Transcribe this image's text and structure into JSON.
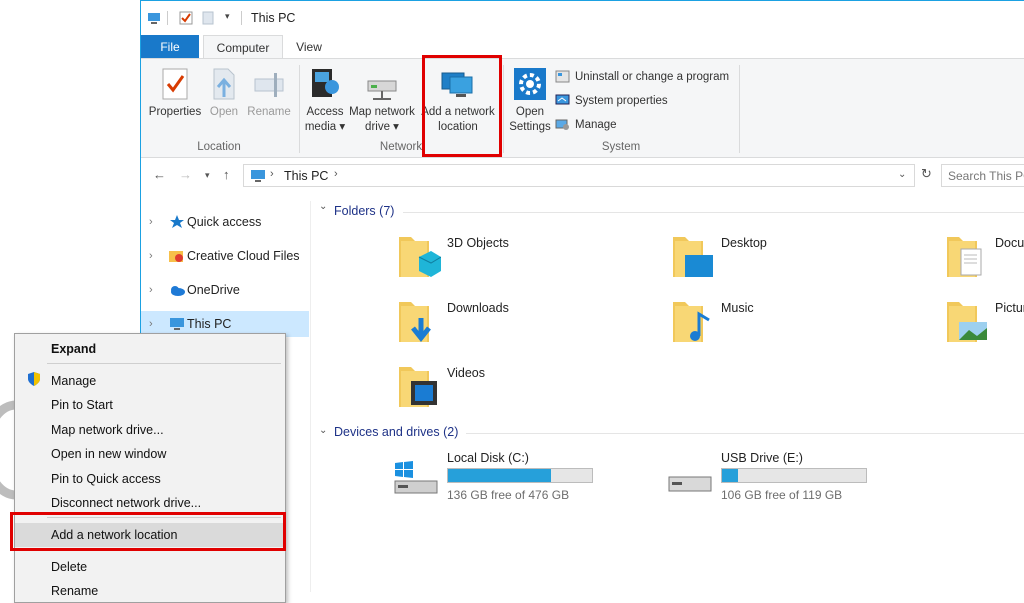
{
  "window": {
    "title": "This PC"
  },
  "tabs": {
    "file": "File",
    "computer": "Computer",
    "view": "View"
  },
  "ribbon": {
    "location": {
      "label": "Location",
      "properties": "Properties",
      "open": "Open",
      "rename": "Rename"
    },
    "network": {
      "label": "Network",
      "access_media_1": "Access",
      "access_media_2": "media ▾",
      "map_drive_1": "Map network",
      "map_drive_2": "drive ▾",
      "add_location_1": "Add a network",
      "add_location_2": "location"
    },
    "system": {
      "label": "System",
      "open_settings_1": "Open",
      "open_settings_2": "Settings",
      "uninstall": "Uninstall or change a program",
      "system_properties": "System properties",
      "manage": "Manage"
    }
  },
  "address": {
    "path": "This PC",
    "search_placeholder": "Search This PC"
  },
  "nav_pane": {
    "items": [
      {
        "label": "Quick access"
      },
      {
        "label": "Creative Cloud Files"
      },
      {
        "label": "OneDrive"
      },
      {
        "label": "This PC"
      }
    ]
  },
  "content": {
    "folders_header": "Folders (7)",
    "folders": [
      {
        "label": "3D Objects"
      },
      {
        "label": "Desktop"
      },
      {
        "label": "Documents"
      },
      {
        "label": "Downloads"
      },
      {
        "label": "Music"
      },
      {
        "label": "Pictures"
      },
      {
        "label": "Videos"
      }
    ],
    "drives_header": "Devices and drives (2)",
    "drives": [
      {
        "name": "Local Disk (C:)",
        "free": "136 GB free of 476 GB",
        "used_fraction": 0.714
      },
      {
        "name": "USB Drive (E:)",
        "free": "106 GB free of 119 GB",
        "used_fraction": 0.109
      }
    ]
  },
  "context_menu": {
    "items": [
      "Expand",
      "Manage",
      "Pin to Start",
      "Map network drive...",
      "Open in new window",
      "Pin to Quick access",
      "Disconnect network drive...",
      "Add a network location",
      "Delete",
      "Rename"
    ]
  },
  "colors": {
    "accent": "#1979ca",
    "highlight_box": "#e00000",
    "drive_bar": "#26a0da",
    "selection": "#cce8ff"
  }
}
